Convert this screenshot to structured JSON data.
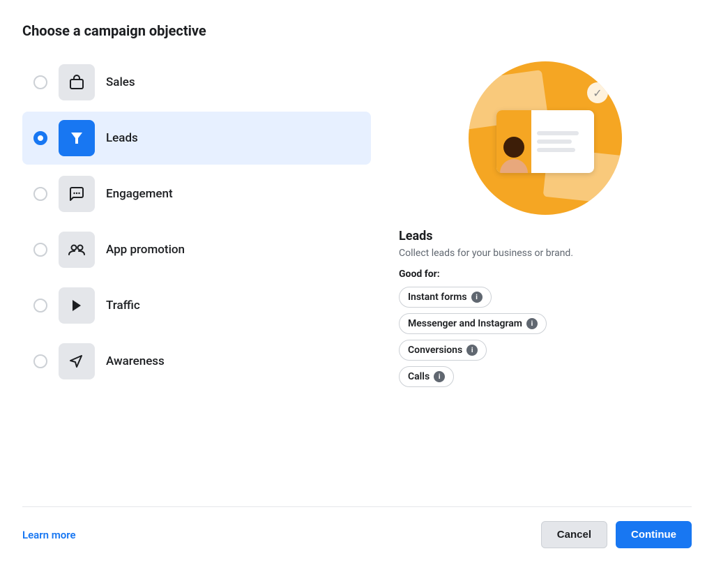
{
  "dialog": {
    "title": "Choose a campaign objective"
  },
  "objectives": [
    {
      "id": "sales",
      "label": "Sales",
      "icon": "🛍️",
      "selected": false
    },
    {
      "id": "leads",
      "label": "Leads",
      "icon": "▼",
      "selected": true
    },
    {
      "id": "engagement",
      "label": "Engagement",
      "icon": "💬",
      "selected": false
    },
    {
      "id": "app-promotion",
      "label": "App promotion",
      "icon": "👥",
      "selected": false
    },
    {
      "id": "traffic",
      "label": "Traffic",
      "icon": "▶",
      "selected": false
    },
    {
      "id": "awareness",
      "label": "Awareness",
      "icon": "📢",
      "selected": false
    }
  ],
  "detail": {
    "name": "Leads",
    "description": "Collect leads for your business or brand.",
    "good_for_label": "Good for:",
    "tags": [
      {
        "id": "instant-forms",
        "label": "Instant forms"
      },
      {
        "id": "messenger-instagram",
        "label": "Messenger and Instagram"
      },
      {
        "id": "conversions",
        "label": "Conversions"
      },
      {
        "id": "calls",
        "label": "Calls"
      }
    ]
  },
  "footer": {
    "learn_more": "Learn more",
    "cancel": "Cancel",
    "continue": "Continue"
  }
}
